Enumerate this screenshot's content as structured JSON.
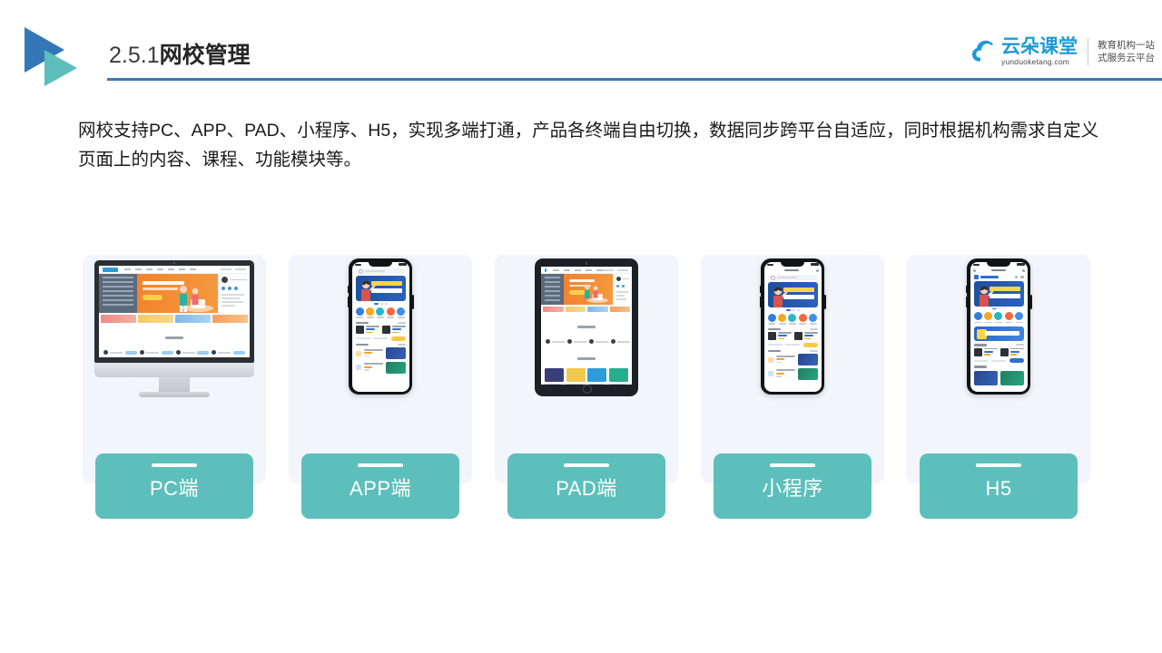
{
  "header": {
    "section_number": "2.5.1",
    "section_title": "网校管理",
    "logo_icon": "double-triangle-play-icon",
    "rule_color": "#3d79b0"
  },
  "brand": {
    "cloud_icon": "cloud-icon",
    "name_cn": "云朵课堂",
    "name_en": "yunduoketang.com",
    "tagline_line1": "教育机构一站",
    "tagline_line2": "式服务云平台",
    "accent_color": "#1b9ad6"
  },
  "intro": {
    "paragraph": "网校支持PC、APP、PAD、小程序、H5，实现多端打通，产品各终端自由切换，数据同步跨平台自适应，同时根据机构需求自定义页面上的内容、课程、功能模块等。"
  },
  "cards": [
    {
      "label": "PC端",
      "device": "desktop-monitor-icon",
      "badge_color": "#5cbfbb",
      "card_bg": "#f2f5fb"
    },
    {
      "label": "APP端",
      "device": "smartphone-icon",
      "badge_color": "#5cbfbb",
      "card_bg": "#f2f5fb"
    },
    {
      "label": "PAD端",
      "device": "tablet-icon",
      "badge_color": "#5cbfbb",
      "card_bg": "#f2f5fb"
    },
    {
      "label": "小程序",
      "device": "smartphone-icon",
      "badge_color": "#5cbfbb",
      "card_bg": "#f2f5fb"
    },
    {
      "label": "H5",
      "device": "smartphone-icon",
      "badge_color": "#5cbfbb",
      "card_bg": "#f2f5fb"
    }
  ]
}
